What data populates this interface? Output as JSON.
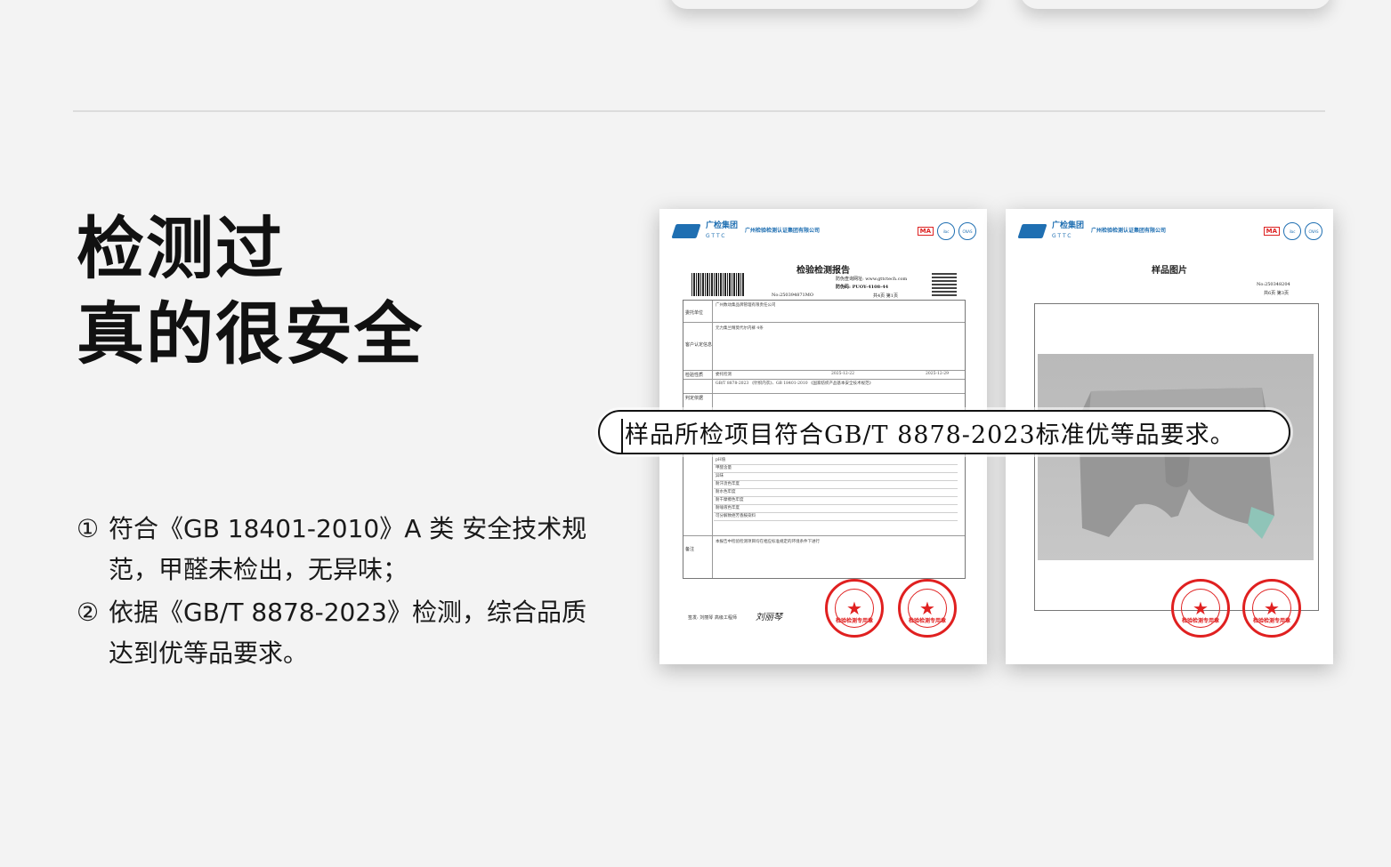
{
  "headline": {
    "line1": "检测过",
    "line2": "真的很安全"
  },
  "points": [
    {
      "num": "①",
      "text": "符合《GB 18401-2010》A 类 安全技术规范，甲醛未检出，无异味；"
    },
    {
      "num": "②",
      "text": "依据《GB/T 8878-2023》检测，综合品质达到优等品要求。"
    }
  ],
  "callout": "样品所检项目符合GB/T 8878-2023标准优等品要求。",
  "report1": {
    "brand": "广检集团",
    "brand_sub": "GTTC",
    "institute": "广州检验检测认证集团有限公司",
    "title": "检验检测报告",
    "report_no": "No:250394871MO",
    "code": "防伪码: PUOY-4108-44",
    "website": "防伪查询网址: www.gttctech.com",
    "pages": "共4页 第1页",
    "rows": [
      {
        "label": "委托单位",
        "value": "广州数动集品牌管理有限责任公司"
      },
      {
        "label": "客户认定信息",
        "value": "元力集兰精莫代尔内裤 4条"
      },
      {
        "label": "检验性质",
        "value": "委托检测"
      },
      {
        "label": "判定依据",
        "value": "GB/T 8878-2023 《针织内衣》、GB 18401-2010 《国家纺织产品基本安全技术规范》"
      },
      {
        "label": "备注",
        "value": "本报告中检验检测项目均在相应标准规定的环境条件下进行"
      }
    ],
    "dates": [
      "2025-12-22",
      "2025-12-29"
    ],
    "items": [
      "pH值",
      "甲醛含量",
      "异味",
      "耐汗渍色牢度",
      "耐水色牢度",
      "耐干摩擦色牢度",
      "耐唾液色牢度",
      "可分解致癌芳香胺染料"
    ],
    "signer": "签发: 刘丽琴 高级工程师",
    "signature": "刘丽琴",
    "stamp_text": "检验检测专用章"
  },
  "report2": {
    "brand": "广检集团",
    "brand_sub": "GTTC",
    "institute": "广州检验检测认证集团有限公司",
    "title": "样品图片",
    "report_no": "No:250348204",
    "pages": "共6页 第3页",
    "stamp_text": "检验检测专用章"
  },
  "colors": {
    "brand_blue": "#1f6fb2",
    "stamp_red": "#e02020"
  }
}
